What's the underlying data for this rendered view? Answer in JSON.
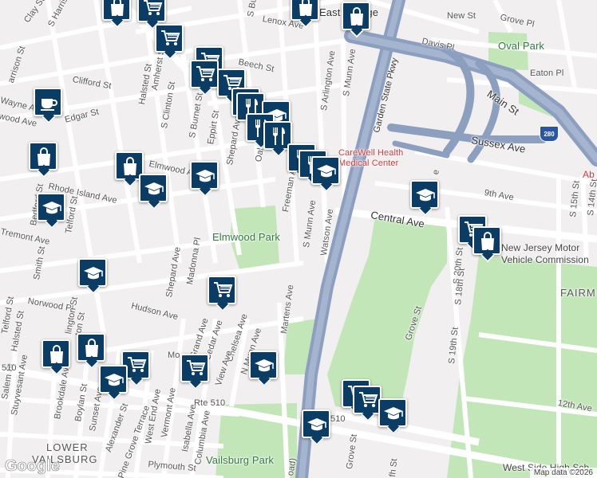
{
  "map": {
    "labels": {
      "east_orange": "East Orange",
      "elmwood_park": "Elmwood Park",
      "vailsburg_park": "Vailsburg Park",
      "oval_park": "Oval Park",
      "hospital_1": "CareWell Health",
      "hospital_2": "Medical Center",
      "garden_state_pkwy": "Garden State Pkwy",
      "njmvc_1": "New Jersey Motor",
      "njmvc_2": "Vehicle Commission",
      "fairmount": "FAIRM",
      "lower": "LOWER",
      "vailsburg": "VAILSBURG",
      "west_side": "West Side High Sch",
      "ab": "Ab",
      "s_harrison_st": "S Harrison St",
      "clay_st": "Clay St",
      "harrison_st": "arrison St",
      "clifford_st": "Clifford St",
      "halsted_st": "Halsted St",
      "amherst_st": "Amherst St",
      "s_clinton_st": "S Clinton St",
      "s_burnet_st": "S Burnet St",
      "eppirt_st": "Eppirt St",
      "shepard_ave_top": "Shepard Ave",
      "oak_st": "Oak St",
      "freeman_ave": "Freeman Ave",
      "s_munn_ave": "S Munn Ave",
      "watson_ave": "Watson Ave",
      "s_arlington_ave": "S Arlington Ave",
      "s_munn_ave_top": "S Munn Ave",
      "lenox_ave": "Lenox Ave",
      "beech_st": "Beech St",
      "s_burnet_top": "S Burn",
      "wayne_ave": "Wayne Ave",
      "edgar_st": "Edgar St",
      "wood_ave": "wood Ave",
      "elmwood_ave": "Elmwood Ave",
      "rhode_island_ave": "Rhode Island Ave",
      "tremont_ave": "Tremont Ave",
      "bedford_st": "Bedford St",
      "telford_st": "Telford St",
      "smith_st": "Smith St",
      "shepard_ave": "Shepard Ave",
      "madonna_pl": "Madonna Pl",
      "norwood_pl": "Norwood Pl",
      "hudson_ave": "Hudson Ave",
      "grand_ave": "Grand Ave",
      "cedar_ave": "Cedar Ave",
      "chelsea_ave": "Chelsea Ave",
      "n_munn_ave": "N Munn Ave",
      "martens_ave": "Martens Ave",
      "view_ave": "View Ave",
      "mo_ave": "Mo",
      "lington_st": "lington St",
      "ton_st": "ton St",
      "telford_st2": "Telford St",
      "halsted_st2": "Halsted St",
      "salem_st": "Salem St",
      "stuyvesant_ave": "Stuyvesant Ave",
      "brookdale_ave": "Brookdale Ave",
      "boylan_st": "Boylan St",
      "sunset_ave": "Sunset Ave",
      "alexander_st": "Alexander St",
      "pine_grove_terrace": "Pine Grove Terrace",
      "west_end_ave": "West End Ave",
      "vermont_ave": "Vermont Ave",
      "isabella_ave": "Isabella Ave",
      "columbia_ave": "Columbia Ave",
      "plymouth_st": "Plymouth St",
      "rte_510": "Rte 510",
      "rte_510_r": "510",
      "rte_510_l": "510",
      "bay_ave": "Ba",
      "oad": "oad)",
      "new_st": "New St",
      "davis_pl": "Davis Pl",
      "grove_pl": "Grove Pl",
      "eaton_pl": "Eaton Pl",
      "main_st": "Main St",
      "sussex_ave": "Sussex Ave",
      "ninth_ave": "9th Ave",
      "central_ave": "Central Ave",
      "grove_st_mid": "Grove St",
      "grove_st_bot": "Grove St",
      "s_20th_st": "S 20th St",
      "s_19th_st": "S 19th St",
      "s_18th_st": "S 18th St",
      "s_15th_st": "S 15th St",
      "s_14th_st": "S 14th St",
      "twelfth_ave": "12th Ave",
      "fh_st": "fh St",
      "s_e": "e",
      "i280": "280"
    },
    "attribution": "Map data ©2026",
    "google": "Google",
    "colors": {
      "background": "#f1eff0",
      "road": "#ffffff",
      "highway": "#8c9fbf",
      "park": "#c3e6b9",
      "pin": "#0b3d64",
      "hospital_text": "#d23b3b",
      "interstate_shield": "#2a56a4"
    },
    "pins": [
      {
        "icon": "cart-icon",
        "label": "grocery"
      },
      {
        "icon": "bag-icon",
        "label": "shopping"
      },
      {
        "icon": "cutlery-icon",
        "label": "restaurant"
      },
      {
        "icon": "cap-icon",
        "label": "school"
      },
      {
        "icon": "cup-icon",
        "label": "cafe"
      }
    ]
  }
}
